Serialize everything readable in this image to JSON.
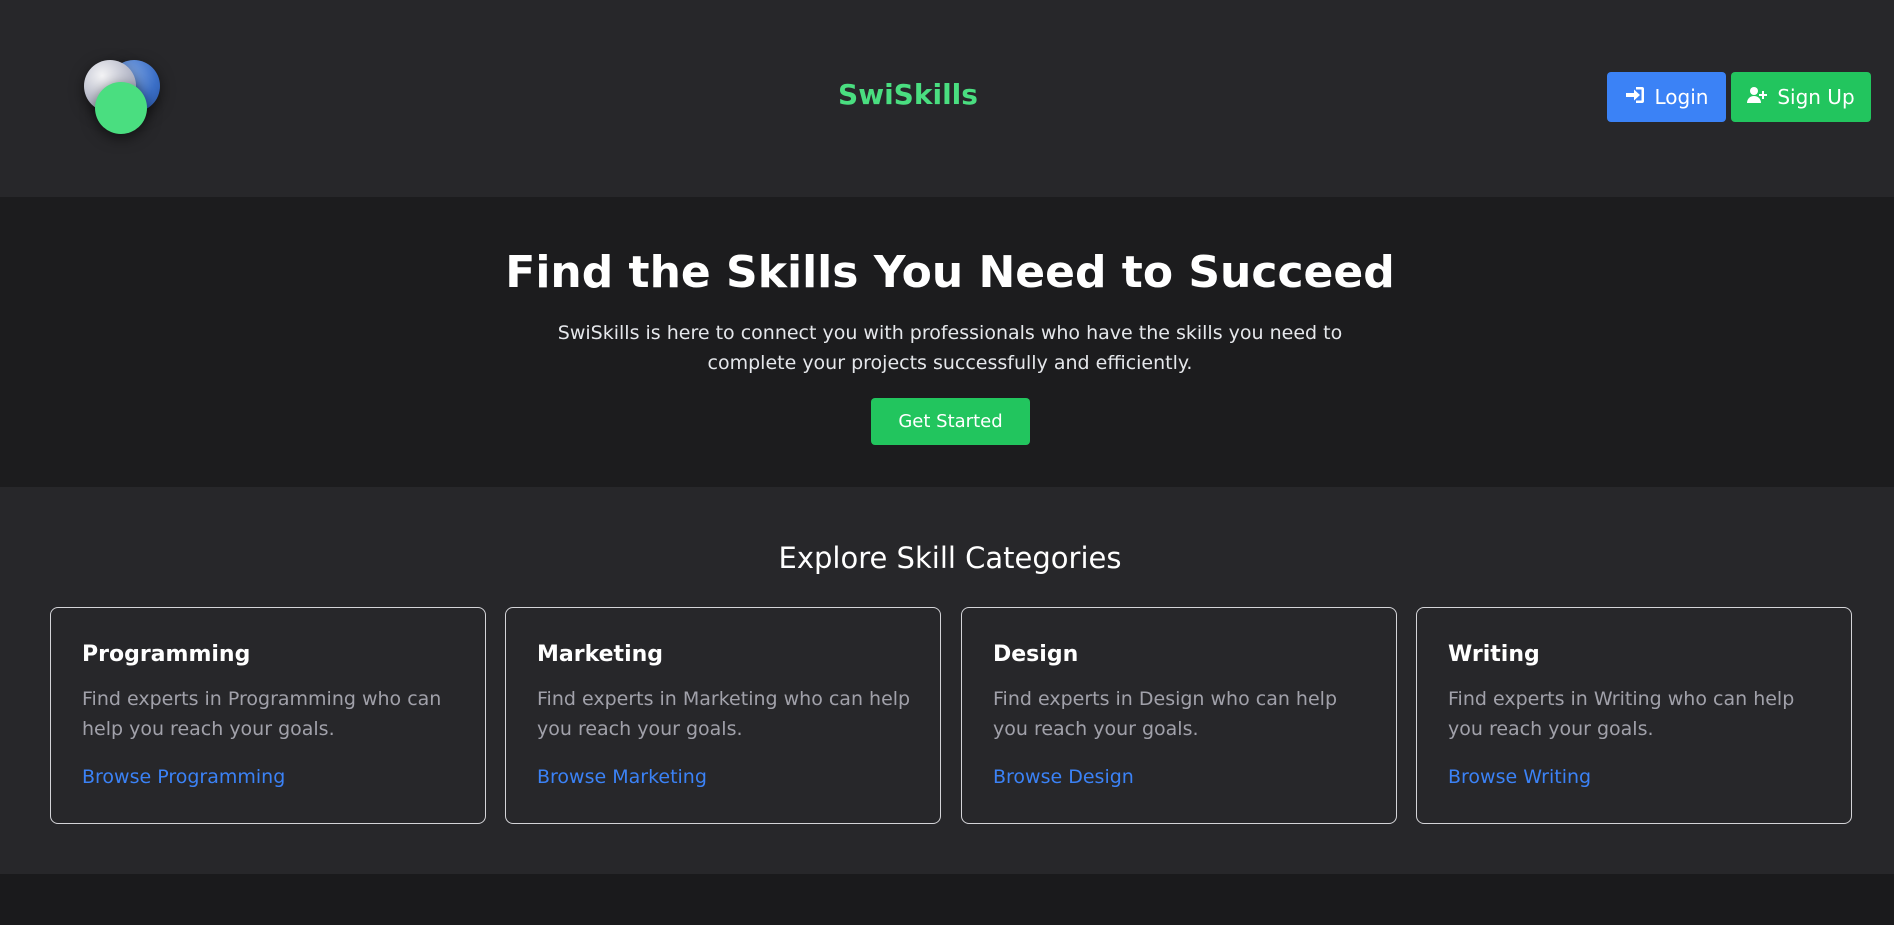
{
  "header": {
    "brand": "SwiSkills",
    "login_label": "Login",
    "signup_label": "Sign Up"
  },
  "hero": {
    "title": "Find the Skills You Need to Succeed",
    "subtitle": "SwiSkills is here to connect you with professionals who have the skills you need to complete your projects successfully and efficiently.",
    "cta_label": "Get Started"
  },
  "categories": {
    "heading": "Explore Skill Categories",
    "items": [
      {
        "title": "Programming",
        "description": "Find experts in Programming who can help you reach your goals.",
        "link": "Browse Programming"
      },
      {
        "title": "Marketing",
        "description": "Find experts in Marketing who can help you reach your goals.",
        "link": "Browse Marketing"
      },
      {
        "title": "Design",
        "description": "Find experts in Design who can help you reach your goals.",
        "link": "Browse Design"
      },
      {
        "title": "Writing",
        "description": "Find experts in Writing who can help you reach your goals.",
        "link": "Browse Writing"
      }
    ]
  },
  "icons": {
    "login": "sign-in-icon",
    "signup": "user-plus-icon"
  },
  "colors": {
    "accent_green": "#22c55e",
    "brand_green": "#4ade80",
    "accent_blue": "#3b82f6",
    "header_bg": "#27272a",
    "hero_bg": "#1c1c1e"
  }
}
